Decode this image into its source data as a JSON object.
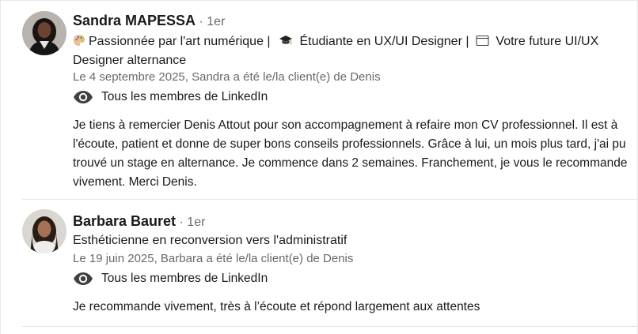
{
  "recommendations": [
    {
      "name": "Sandra MAPESSA",
      "degree": "· 1er",
      "headline": {
        "part1_icon": "artist-palette-icon",
        "part1": "Passionnée par l'art numérique | ",
        "part2_icon": "graduation-cap-icon",
        "part2": " Étudiante en UX/UI Designer | ",
        "part3_icon": "browser-window-icon",
        "part3": " Votre future UI/UX Designer alternance"
      },
      "meta": "Le 4 septembre 2025, Sandra a été le/la client(e) de Denis",
      "visibility_icon": "eye-icon",
      "visibility": "Tous les membres de LinkedIn",
      "text": "Je tiens à remercier Denis Attout pour son accompagnement à refaire mon CV professionnel. Il est à l'écoute, patient et donne de super bons conseils professionnels. Grâce à lui, un mois plus tard, j'ai pu trouvé un stage en alternance. Je commence dans 2 semaines. Franchement, je vous le recommande vivement. Merci Denis."
    },
    {
      "name": "Barbara Bauret",
      "degree": "· 1er",
      "headline_text": "Esthéticienne en reconversion vers l'administratif",
      "meta": "Le 19 juin 2025, Barbara a été le/la client(e) de Denis",
      "visibility_icon": "eye-icon",
      "visibility": "Tous les membres de LinkedIn",
      "text": "Je recommande vivement, très à l’écoute et répond largement aux attentes"
    }
  ],
  "colors": {
    "primary_text": "#1a1a1a",
    "secondary_text": "#666666",
    "divider": "#e6e6e6"
  }
}
